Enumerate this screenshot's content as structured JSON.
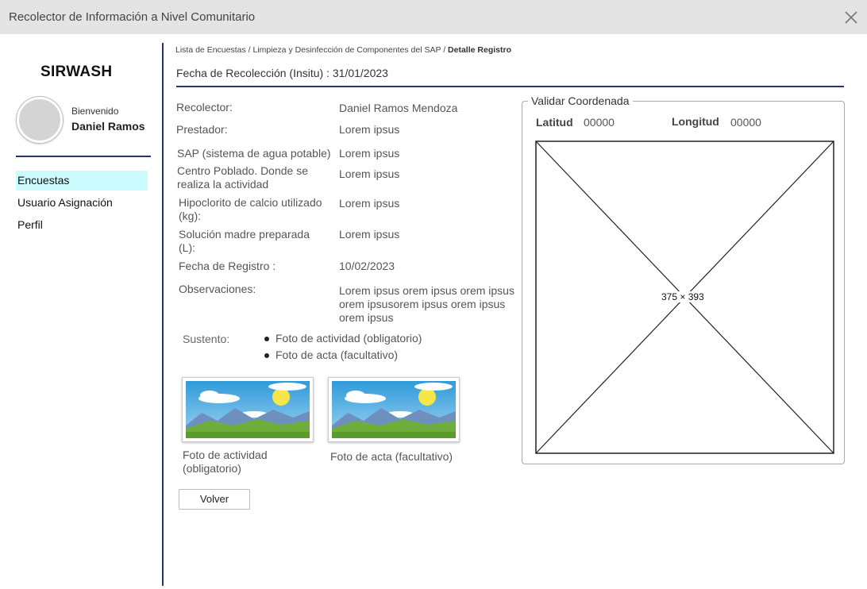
{
  "window": {
    "title": "Recolector de Información a Nivel Comunitario",
    "close_icon": "close-icon"
  },
  "sidebar": {
    "brand": "SIRWASH",
    "welcome": "Bienvenido",
    "user_name": "Daniel Ramos",
    "items": [
      {
        "label": "Encuestas",
        "active": true
      },
      {
        "label": "Usuario Asignación",
        "active": false
      },
      {
        "label": "Perfil",
        "active": false
      }
    ]
  },
  "breadcrumb": {
    "items": [
      "Lista de Encuestas",
      "Limpieza y Desinfección de Componentes del SAP"
    ],
    "separator": "/",
    "current": "Detalle Registro"
  },
  "page_title": "Fecha de Recolección (Insitu) : 31/01/2023",
  "details": {
    "recolector": {
      "label": "Recolector:",
      "value": "Daniel Ramos Mendoza"
    },
    "prestador": {
      "label": "Prestador:",
      "value": "Lorem ipsus"
    },
    "sap": {
      "label": "SAP (sistema de agua potable)",
      "value": "Lorem ipsus"
    },
    "centro": {
      "label_line1": "Centro Poblado. Donde se",
      "label_line2": "realiza la actividad",
      "value": "Lorem ipsus"
    },
    "hipoclorito": {
      "label_line1": "Hipoclorito de calcio utilizado",
      "label_line2": "(kg):",
      "value": "Lorem ipsus"
    },
    "solucion": {
      "label_line1": "Solución madre preparada",
      "label_line2": "(L):",
      "value": "Lorem ipsus"
    },
    "fecha_registro": {
      "label": "Fecha de Registro :",
      "value": "10/02/2023"
    },
    "observaciones": {
      "label": "Observaciones:",
      "value_line1": "Lorem ipsus orem ipsus orem ipsus",
      "value_line2": "orem ipsusorem ipsus orem ipsus",
      "value_line3": "orem ipsus"
    }
  },
  "sustento": {
    "label": "Sustento:",
    "items": [
      "Foto de actividad (obligatorio)",
      "Foto de acta (facultativo)"
    ]
  },
  "photos": [
    {
      "caption_line1": "Foto de actividad",
      "caption_line2": "(obligatorio)",
      "icon": "landscape-image-icon"
    },
    {
      "caption_line1": "Foto de acta (facultativo)",
      "caption_line2": "",
      "icon": "landscape-image-icon"
    }
  ],
  "buttons": {
    "back": "Volver"
  },
  "coordinates": {
    "legend": "Validar Coordenada",
    "lat_label": "Latitud",
    "lat_value": "00000",
    "lon_label": "Longitud",
    "lon_value": "00000",
    "map_placeholder": "375 × 393"
  },
  "colors": {
    "accent": "#24356e",
    "active_nav": "#ccfbfd",
    "titlebar": "#e4e4e4"
  }
}
